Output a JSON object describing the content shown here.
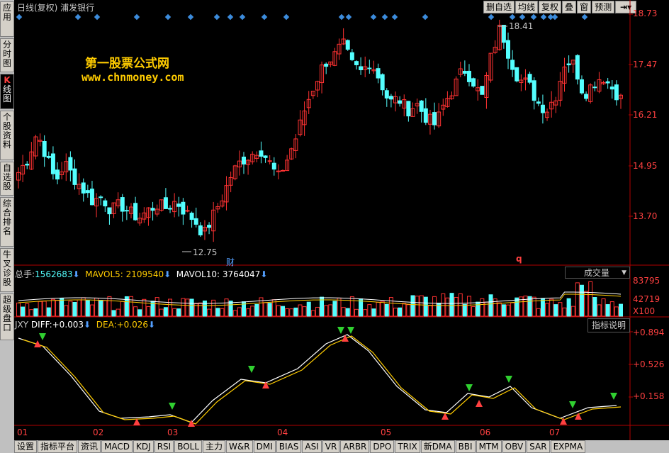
{
  "sidebar": {
    "tabs": [
      {
        "label": "应用",
        "active": false
      },
      {
        "label": "分时图",
        "active": false
      },
      {
        "label": "K线图",
        "active": true
      },
      {
        "label": "个股资料",
        "active": false
      },
      {
        "label": "自选股",
        "active": false
      },
      {
        "label": "综合排名",
        "active": false
      },
      {
        "label": "牛叉诊股",
        "active": false
      },
      {
        "label": "超级盘口",
        "active": false
      }
    ]
  },
  "header": {
    "title": "日线(复权)  浦发银行"
  },
  "toolbar": {
    "buttons": [
      "删自选",
      "均线",
      "复权",
      "叠",
      "窗",
      "预测"
    ],
    "icon": "exit-arrow-icon"
  },
  "watermark": {
    "line1": "第一股票公式网",
    "line2": "www.chnmoney.com"
  },
  "price_axis": {
    "labels": [
      "18.73",
      "17.47",
      "16.21",
      "14.95",
      "13.70"
    ]
  },
  "annotations": {
    "high": "18.41",
    "low": "12.75",
    "cai": "财",
    "q": "q"
  },
  "volume": {
    "total_label": "总手:",
    "total_value": "1562683",
    "ma5_label": "MAVOL5:",
    "ma5_value": "2109540",
    "ma10_label": "MAVOL10:",
    "ma10_value": "3764047",
    "dropdown": "成交量",
    "axis": [
      "83795",
      "42719",
      "X100"
    ]
  },
  "indicator": {
    "name": "JXY",
    "diff_label": "DIFF:",
    "diff_value": "+0.003",
    "dea_label": "DEA:",
    "dea_value": "+0.026",
    "help_button": "指标说明",
    "axis": [
      "+0.894",
      "+0.526",
      "+0.158"
    ]
  },
  "x_axis": {
    "months": [
      "01",
      "02",
      "03",
      "04",
      "05",
      "06",
      "07"
    ]
  },
  "bottom_tabs": [
    "设置",
    "指标平台",
    "资讯",
    "MACD",
    "KDJ",
    "RSI",
    "BOLL",
    "主力",
    "W&R",
    "DMI",
    "BIAS",
    "ASI",
    "VR",
    "ARBR",
    "DPO",
    "TRIX",
    "新DMA",
    "BBI",
    "MTM",
    "OBV",
    "SAR",
    "EXPMA"
  ],
  "colors": {
    "up": "#ff3232",
    "down": "#54ffff",
    "axis": "#b00000",
    "accent": "#ffcc00",
    "diamond": "#3c8cdc"
  },
  "chart_data": {
    "type": "candlestick",
    "close_path": [
      14.55,
      14.9,
      15.6,
      15.0,
      14.3,
      14.8,
      14.4,
      14.1,
      13.8,
      13.9,
      13.55,
      13.7,
      13.5,
      13.35,
      13.55,
      13.7,
      13.6,
      13.8,
      13.5,
      13.3,
      12.9,
      13.4,
      13.9,
      14.5,
      14.85,
      15.0,
      15.2,
      14.85,
      14.4,
      14.9,
      15.5,
      16.3,
      16.9,
      17.45,
      17.6,
      17.95,
      17.4,
      17.2,
      17.5,
      17.0,
      16.4,
      16.5,
      16.2,
      16.35,
      16.0,
      15.8,
      16.4,
      16.8,
      17.3,
      17.0,
      16.5,
      17.6,
      18.4,
      17.6,
      17.0,
      16.9,
      16.4,
      16.2,
      16.6,
      17.5,
      17.4,
      16.6,
      16.9,
      17.1,
      16.8,
      16.5
    ],
    "high": 18.41,
    "low": 12.75
  }
}
